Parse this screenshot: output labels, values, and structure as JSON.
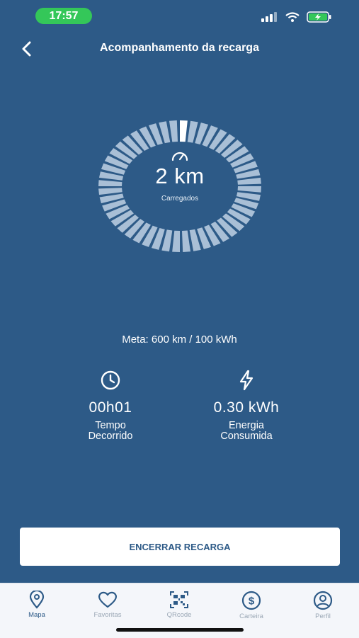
{
  "status_bar": {
    "time": "17:57"
  },
  "header": {
    "title": "Acompanhamento da recarga",
    "back_icon": "chevron-left-icon"
  },
  "charge": {
    "distance": "2 km",
    "label": "Carregados",
    "progress": 0.0033
  },
  "goal": "Meta: 600 km / 100 kWh",
  "stats": {
    "time": {
      "value": "00h01",
      "label_line1": "Tempo",
      "label_line2": "Decorrido",
      "icon": "clock-icon"
    },
    "energy": {
      "value": "0.30 kWh",
      "label_line1": "Energia",
      "label_line2": "Consumida",
      "icon": "lightning-icon"
    }
  },
  "end_button": "ENCERRAR RECARGA",
  "nav": [
    {
      "label": "Mapa",
      "icon": "map-pin-icon",
      "active": true
    },
    {
      "label": "Favoritas",
      "icon": "heart-icon",
      "active": false
    },
    {
      "label": "QRcode",
      "icon": "qrcode-icon",
      "active": false
    },
    {
      "label": "Carteira",
      "icon": "wallet-icon",
      "active": false
    },
    {
      "label": "Perfil",
      "icon": "profile-icon",
      "active": false
    }
  ],
  "colors": {
    "background": "#2d5a87",
    "ring_segment": "#a9bfd6",
    "ring_active": "#ffffff",
    "status_pill": "#34c759",
    "nav_active": "#2d5a87",
    "nav_inactive": "#9aa7b5"
  }
}
